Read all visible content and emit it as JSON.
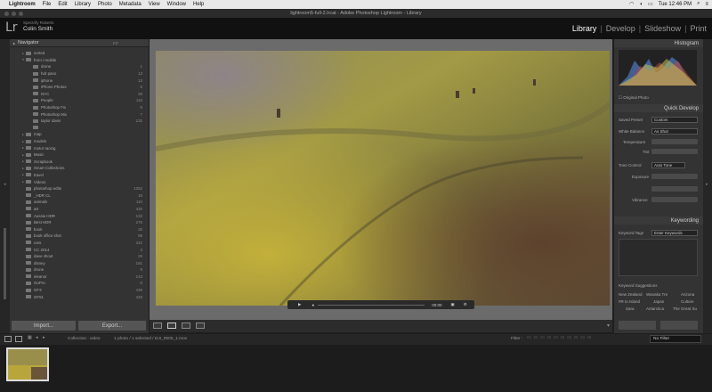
{
  "menubar": {
    "app": "Lightroom",
    "items": [
      "File",
      "Edit",
      "Library",
      "Photo",
      "Metadata",
      "View",
      "Window",
      "Help"
    ],
    "clock": "Tue 12:46 PM"
  },
  "window": {
    "title": "lightroom5-full-2.lrcat - Adobe Photoshop Lightroom - Library"
  },
  "identity": {
    "subtitle": "Spectrify Roberts",
    "name": "Colin Smith"
  },
  "modules": [
    "Library",
    "Develop",
    "Slideshow",
    "Print"
  ],
  "left_panel": {
    "header": "Navigator",
    "header_right": "FIT",
    "folders": [
      {
        "name": "sorted",
        "count": "",
        "depth": 1,
        "tri": "▸"
      },
      {
        "name": "from i-mobile",
        "count": "",
        "depth": 1,
        "tri": "▾"
      },
      {
        "name": "drone",
        "count": "1",
        "depth": 2,
        "tri": ""
      },
      {
        "name": "hdr pano",
        "count": "13",
        "depth": 2,
        "tri": ""
      },
      {
        "name": "iphone",
        "count": "13",
        "depth": 2,
        "tri": ""
      },
      {
        "name": "iPhone Photos",
        "count": "5",
        "depth": 2,
        "tri": ""
      },
      {
        "name": "NYC",
        "count": "28",
        "depth": 2,
        "tri": ""
      },
      {
        "name": "People",
        "count": "116",
        "depth": 2,
        "tri": ""
      },
      {
        "name": "Photoshop Fix",
        "count": "9",
        "depth": 2,
        "tri": ""
      },
      {
        "name": "Photoshop Mix",
        "count": "7",
        "depth": 2,
        "tri": ""
      },
      {
        "name": "taylor davis",
        "count": "132",
        "depth": 2,
        "tri": ""
      },
      {
        "name": "",
        "count": "",
        "depth": 2,
        "tri": ""
      },
      {
        "name": "map",
        "count": "",
        "depth": 1,
        "tri": "▸"
      },
      {
        "name": "models",
        "count": "",
        "depth": 1,
        "tri": "▸"
      },
      {
        "name": "motor racing",
        "count": "",
        "depth": 1,
        "tri": "▸"
      },
      {
        "name": "Music",
        "count": "",
        "depth": 1,
        "tri": "▸"
      },
      {
        "name": "Scrapbook",
        "count": "",
        "depth": 1,
        "tri": "▸"
      },
      {
        "name": "Smart Collections",
        "count": "",
        "depth": 1,
        "tri": "▸"
      },
      {
        "name": "travel",
        "count": "",
        "depth": 1,
        "tri": "▸"
      },
      {
        "name": "Videos",
        "count": "",
        "depth": 1,
        "tri": "▸"
      },
      {
        "name": "photoshop edits",
        "count": "1352",
        "depth": 1,
        "tri": ""
      },
      {
        "name": "_HDR CL",
        "count": "18",
        "depth": 1,
        "tri": ""
      },
      {
        "name": "animals",
        "count": "110",
        "depth": 1,
        "tri": ""
      },
      {
        "name": "art",
        "count": "426",
        "depth": 1,
        "tri": ""
      },
      {
        "name": "Aussie HDR",
        "count": "133",
        "depth": 1,
        "tri": ""
      },
      {
        "name": "Best HDR",
        "count": "276",
        "depth": 1,
        "tri": ""
      },
      {
        "name": "book",
        "count": "25",
        "depth": 1,
        "tri": ""
      },
      {
        "name": "book office shot",
        "count": "59",
        "depth": 1,
        "tri": ""
      },
      {
        "name": "cars",
        "count": "342",
        "depth": 1,
        "tri": ""
      },
      {
        "name": "CC 2014",
        "count": "3",
        "depth": 1,
        "tri": ""
      },
      {
        "name": "dave shoot",
        "count": "29",
        "depth": 1,
        "tri": ""
      },
      {
        "name": "disney",
        "count": "181",
        "depth": 1,
        "tri": ""
      },
      {
        "name": "drone",
        "count": "8",
        "depth": 1,
        "tri": ""
      },
      {
        "name": "eleanor",
        "count": "143",
        "depth": 1,
        "tri": ""
      },
      {
        "name": "GoPro",
        "count": "8",
        "depth": 1,
        "tri": ""
      },
      {
        "name": "GF3",
        "count": "436",
        "depth": 1,
        "tri": ""
      },
      {
        "name": "GF51",
        "count": "433",
        "depth": 1,
        "tri": ""
      }
    ],
    "import_label": "Import...",
    "export_label": "Export..."
  },
  "video": {
    "time": "00:00"
  },
  "right_panel": {
    "histogram": "Histogram",
    "original_photo": "Original Photo",
    "quick_develop": "Quick Develop",
    "saved_preset_label": "Saved Preset",
    "saved_preset_value": "Custom",
    "white_balance_label": "White Balance",
    "white_balance_value": "As Shot",
    "temperature_label": "Temperature",
    "tint_label": "Tint",
    "tone_control_label": "Tone Control",
    "tone_control_value": "Auto Tone",
    "exposure_label": "Exposure",
    "vibrance_label": "Vibrance",
    "keywording": "Keywording",
    "keyword_tags_label": "Keyword Tags",
    "keyword_tags_value": "Enter Keywords",
    "keyword_suggestions": "Keyword Suggestions",
    "suggestions": [
      "New Zealand",
      "Wanaka Tre",
      "Arizona",
      "#R to Island",
      "Japan",
      "Culture",
      "Sara",
      "Antarctica",
      "The Great Su"
    ]
  },
  "filmstrip": {
    "source": "Collection : video",
    "info": "1 photo / 1 selected / DJI_0500_1.mov",
    "filter_label": "Filter :",
    "filter_value": "No Filter"
  },
  "colors": {
    "accent": "#ffffff",
    "panel": "#333333"
  }
}
